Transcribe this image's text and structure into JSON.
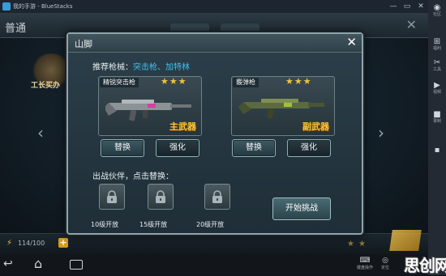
{
  "window": {
    "title": "我的手游 - BlueStacks",
    "controls": [
      "minimize-icon",
      "restore-icon",
      "close-icon"
    ]
  },
  "background": {
    "title": "普通",
    "stage_label": "工长买办",
    "energy": "114/100",
    "close_icon": "close-icon",
    "left_arrow": "chevron-left-icon",
    "right_arrow": "chevron-right-icon"
  },
  "dialog": {
    "title": "山脚",
    "close_icon": "close-icon",
    "recommended_label": "推荐枪械：",
    "recommended_weapons": "突击枪、加特林",
    "weapons": [
      {
        "name": "精锐突击枪",
        "stars": "★★★",
        "role": "主武器",
        "replace_label": "替换",
        "upgrade_label": "强化"
      },
      {
        "name": "霰弹枪",
        "stars": "★★★",
        "role": "副武器",
        "replace_label": "替换",
        "upgrade_label": "强化"
      }
    ],
    "partner_label": "出战伙伴，点击替换：",
    "partner_slots": [
      {
        "unlock_label": "10级开放",
        "icon": "lock-icon"
      },
      {
        "unlock_label": "15级开放",
        "icon": "lock-icon"
      },
      {
        "unlock_label": "20级开放",
        "icon": "lock-icon"
      }
    ],
    "start_label": "开始挑战"
  },
  "sidebar": {
    "items": [
      {
        "label": "社区",
        "icon": "community-icon"
      },
      {
        "label": "福利",
        "icon": "gift-icon"
      },
      {
        "label": "工具",
        "icon": "tools-icon"
      },
      {
        "label": "视频",
        "icon": "video-icon"
      },
      {
        "label": "录制",
        "icon": "camera-icon"
      }
    ]
  },
  "navbar": {
    "items": [
      {
        "label": "键盘操作",
        "icon": "keyboard-icon"
      },
      {
        "label": "定位",
        "icon": "location-icon"
      }
    ]
  },
  "watermark": "思创网",
  "colors": {
    "accent_blue": "#3ec0ee",
    "gold": "#f6c744",
    "dialog_bg": "#2c3f4a"
  }
}
